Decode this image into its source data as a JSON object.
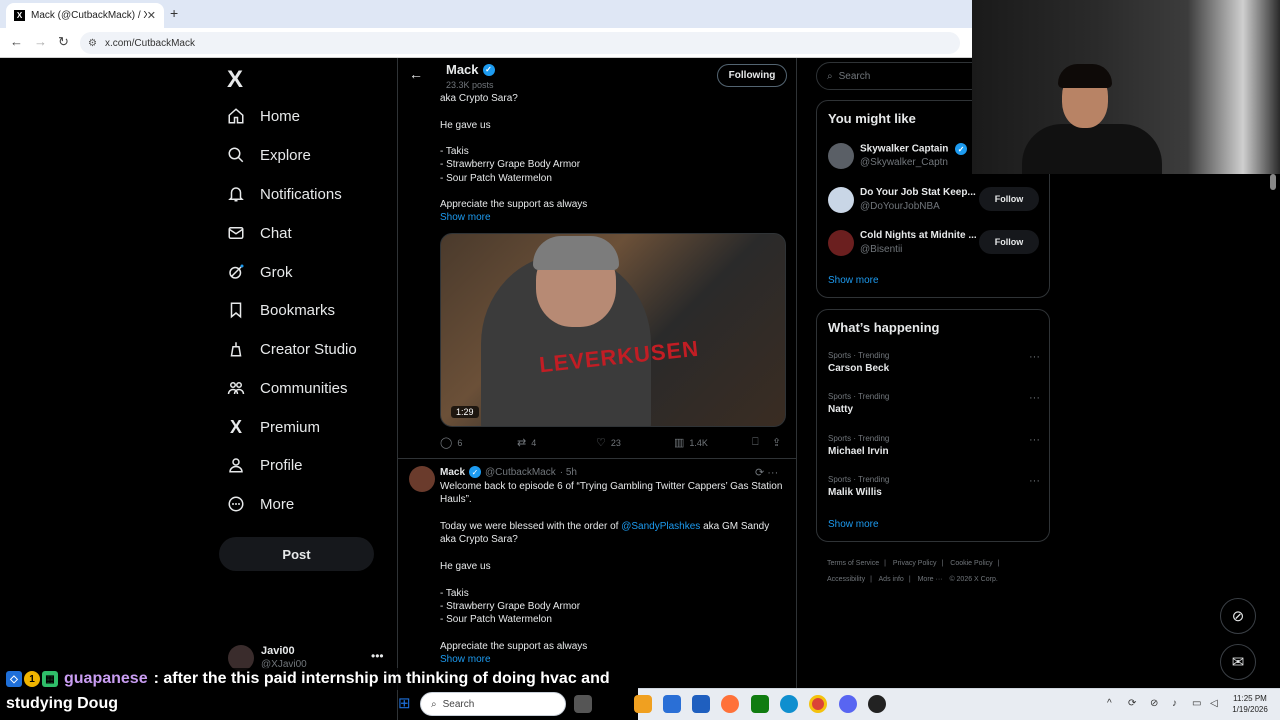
{
  "browser": {
    "tab_title": "Mack (@CutbackMack) / X",
    "tab_close": "✕",
    "new_tab": "+",
    "url": "x.com/CutbackMack"
  },
  "nav": {
    "logo": "X",
    "items": [
      {
        "label": "Home",
        "icon": "home-icon"
      },
      {
        "label": "Explore",
        "icon": "search-icon"
      },
      {
        "label": "Notifications",
        "icon": "bell-icon"
      },
      {
        "label": "Chat",
        "icon": "mail-icon"
      },
      {
        "label": "Grok",
        "icon": "grok-icon"
      },
      {
        "label": "Bookmarks",
        "icon": "bookmark-icon"
      },
      {
        "label": "Creator Studio",
        "icon": "creator-icon"
      },
      {
        "label": "Communities",
        "icon": "communities-icon"
      },
      {
        "label": "Premium",
        "icon": "x-icon"
      },
      {
        "label": "Profile",
        "icon": "person-icon"
      },
      {
        "label": "More",
        "icon": "more-circle-icon"
      }
    ],
    "post_label": "Post",
    "account": {
      "name": "Javi00",
      "handle": "@XJavi00",
      "more": "•••"
    }
  },
  "profile_header": {
    "name": "Mack",
    "posts": "23.3K posts",
    "following_label": "Following"
  },
  "tweet1": {
    "text": "aka Crypto Sara?\n\nHe gave us\n\n- Takis\n- Strawberry Grape Body Armor\n- Sour Patch Watermelon\n\nAppreciate the support as always",
    "show_more": "Show more",
    "video_shirt_text": "LEVERKUSEN",
    "duration": "1:29",
    "replies": "6",
    "reposts": "4",
    "likes": "23",
    "views": "1.4K"
  },
  "tweet2": {
    "name": "Mack",
    "handle": "@CutbackMack",
    "time": "· 5h",
    "line1": "Welcome back to episode 6 of “Trying Gambling Twitter Cappers’ Gas Station Hauls”.",
    "line2_pre": "Today we were blessed with the order of ",
    "line2_link": "@SandyPlashkes",
    "line2_post": " aka GM Sandy aka Crypto Sara?",
    "rest": "He gave us\n\n- Takis\n- Strawberry Grape Body Armor\n- Sour Patch Watermelon\n\nAppreciate the support as always",
    "show_more": "Show more"
  },
  "search": {
    "placeholder": "Search"
  },
  "you_might_like": {
    "title": "You might like",
    "users": [
      {
        "name": "Skywalker Captain",
        "handle": "@Skywalker_Captn",
        "verified": true,
        "color": "#5a5f66"
      },
      {
        "name": "Do Your Job Stat Keep...",
        "handle": "@DoYourJobNBA",
        "follow": "Follow",
        "color": "#c9d6e6"
      },
      {
        "name": "Cold Nights at Midnite ...",
        "handle": "@Bisentii",
        "follow": "Follow",
        "color": "#6b1f1f"
      }
    ],
    "show_more": "Show more"
  },
  "whats_happening": {
    "title": "What’s happening",
    "trends": [
      {
        "category": "Sports · Trending",
        "name": "Carson Beck"
      },
      {
        "category": "Sports · Trending",
        "name": "Natty"
      },
      {
        "category": "Sports · Trending",
        "name": "Michael Irvin"
      },
      {
        "category": "Sports · Trending",
        "name": "Malik Willis"
      }
    ],
    "show_more": "Show more"
  },
  "footer": {
    "links": [
      "Terms of Service",
      "|",
      "Privacy Policy",
      "|",
      "Cookie Policy",
      "|",
      "Accessibility",
      "|",
      "Ads info",
      "|",
      "More ···",
      "© 2026 X Corp."
    ]
  },
  "chat": {
    "user": "guapanese",
    "line1": ": after the this paid internship im thinking of doing hvac and",
    "line2": "studying Doug"
  },
  "taskbar": {
    "search_placeholder": "Search",
    "time": "11:25 PM",
    "date": "1/19/2026"
  },
  "colors": {
    "accent": "#1d9bf0",
    "background": "#000000",
    "border": "#2f3336",
    "muted": "#71767b"
  }
}
